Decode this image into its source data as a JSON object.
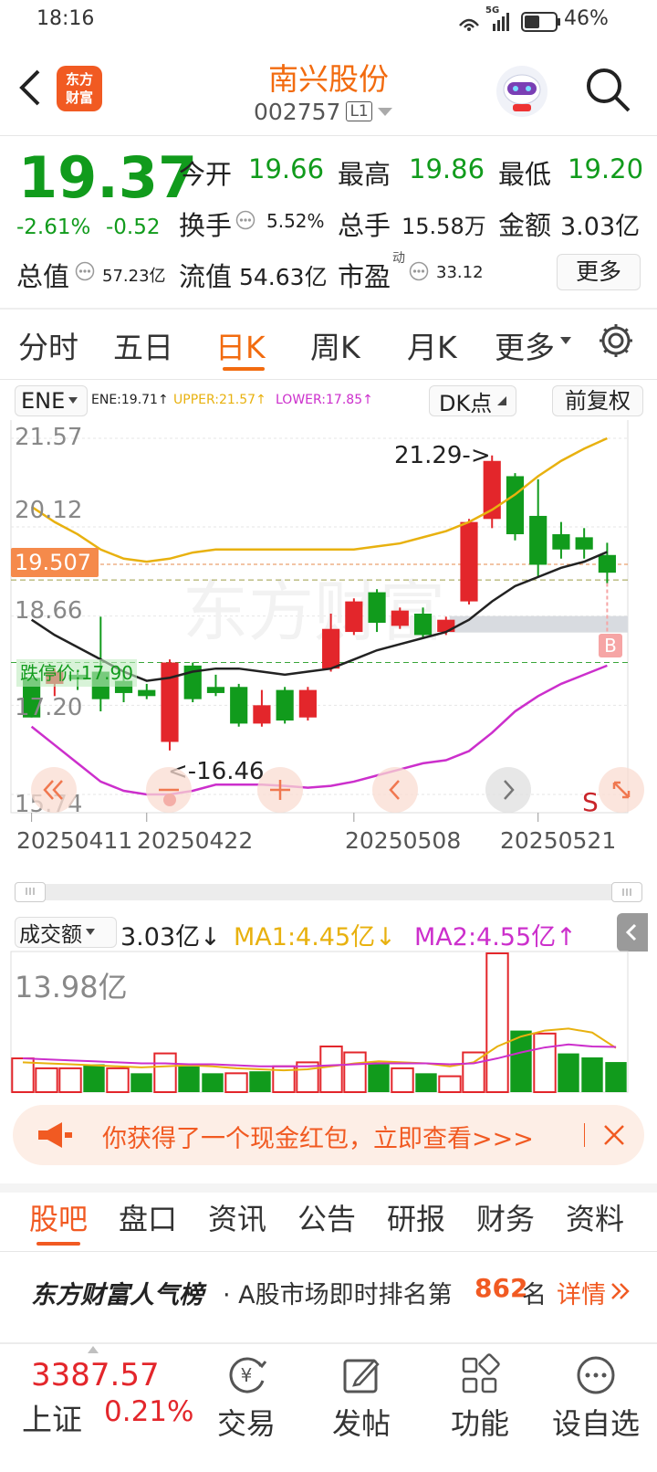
{
  "status_bar": {
    "time": "18:16",
    "network": "5G",
    "battery": "46%"
  },
  "header": {
    "title": "南兴股份",
    "code": "002757",
    "level": "L1",
    "logo_text": "东方财富"
  },
  "quote": {
    "price": "19.37",
    "change_pct": "-2.61%",
    "change": "-0.52",
    "open_label": "今开",
    "open": "19.66",
    "high_label": "最高",
    "high": "19.86",
    "low_label": "最低",
    "low": "19.20",
    "turnover_label": "换手",
    "turnover": "5.52%",
    "volume_label": "总手",
    "volume": "15.58万",
    "amount_label": "金额",
    "amount": "3.03亿",
    "mktcap_label": "总值",
    "mktcap": "57.23亿",
    "float_label": "流值",
    "float": "54.63亿",
    "pe_label": "市盈",
    "pe_sup": "动",
    "pe": "33.12",
    "more_button": "更多"
  },
  "tabs": [
    "分时",
    "五日",
    "日K",
    "周K",
    "月K",
    "更多"
  ],
  "active_tab": "日K",
  "indicator": {
    "name": "ENE",
    "ene": "ENE:19.71↑",
    "upper": "UPPER:21.57↑",
    "lower": "LOWER:17.85↑",
    "dk_button": "DK点",
    "adjust_button": "前复权"
  },
  "chart_data": [
    {
      "type": "candlestick",
      "y_ticks": [
        "21.57",
        "20.12",
        "18.66",
        "17.20",
        "15.74"
      ],
      "ylim": [
        15.74,
        21.57
      ],
      "price_tag": "19.507",
      "support_label": "跌停价:17.90",
      "high_annotation": "21.29->",
      "low_annotation": "<-16.46",
      "x_ticks": [
        "20250411",
        "20250422",
        "20250508",
        "20250521"
      ],
      "signals": [
        "B",
        "S"
      ],
      "candles": [
        {
          "o": 17.65,
          "c": 17.0,
          "h": 17.65,
          "l": 17.0
        },
        {
          "o": 17.55,
          "c": 17.75,
          "h": 17.8,
          "l": 17.35
        },
        {
          "o": 17.7,
          "c": 17.62,
          "h": 17.75,
          "l": 17.45
        },
        {
          "o": 17.75,
          "c": 17.3,
          "h": 18.65,
          "l": 17.1
        },
        {
          "o": 17.6,
          "c": 17.4,
          "h": 17.7,
          "l": 17.25
        },
        {
          "o": 17.45,
          "c": 17.35,
          "h": 17.55,
          "l": 17.3
        },
        {
          "o": 16.6,
          "c": 17.9,
          "h": 17.95,
          "l": 16.46
        },
        {
          "o": 17.85,
          "c": 17.3,
          "h": 17.9,
          "l": 17.25
        },
        {
          "o": 17.5,
          "c": 17.4,
          "h": 17.7,
          "l": 17.35
        },
        {
          "o": 17.5,
          "c": 16.9,
          "h": 17.55,
          "l": 16.85
        },
        {
          "o": 16.9,
          "c": 17.2,
          "h": 17.45,
          "l": 16.85
        },
        {
          "o": 17.45,
          "c": 16.95,
          "h": 17.5,
          "l": 16.9
        },
        {
          "o": 17.0,
          "c": 17.45,
          "h": 17.5,
          "l": 16.95
        },
        {
          "o": 17.8,
          "c": 18.45,
          "h": 18.7,
          "l": 17.75
        },
        {
          "o": 18.4,
          "c": 18.9,
          "h": 18.95,
          "l": 18.35
        },
        {
          "o": 19.05,
          "c": 18.55,
          "h": 19.1,
          "l": 18.4
        },
        {
          "o": 18.5,
          "c": 18.75,
          "h": 18.8,
          "l": 18.45
        },
        {
          "o": 18.7,
          "c": 18.35,
          "h": 18.8,
          "l": 18.3
        },
        {
          "o": 18.4,
          "c": 18.6,
          "h": 18.65,
          "l": 18.35
        },
        {
          "o": 18.9,
          "c": 20.2,
          "h": 20.25,
          "l": 18.85
        },
        {
          "o": 20.25,
          "c": 21.2,
          "h": 21.29,
          "l": 20.1
        },
        {
          "o": 20.95,
          "c": 20.0,
          "h": 21.0,
          "l": 19.9
        },
        {
          "o": 20.3,
          "c": 19.5,
          "h": 20.9,
          "l": 19.3
        },
        {
          "o": 20.0,
          "c": 19.75,
          "h": 20.2,
          "l": 19.6
        },
        {
          "o": 19.95,
          "c": 19.75,
          "h": 20.1,
          "l": 19.6
        },
        {
          "o": 19.66,
          "c": 19.37,
          "h": 19.86,
          "l": 19.2
        }
      ],
      "upper": [
        20.45,
        20.2,
        20.0,
        19.75,
        19.6,
        19.55,
        19.6,
        19.7,
        19.75,
        19.75,
        19.75,
        19.75,
        19.75,
        19.75,
        19.75,
        19.8,
        19.85,
        19.95,
        20.05,
        20.2,
        20.4,
        20.65,
        20.95,
        21.2,
        21.4,
        21.57
      ],
      "mid": [
        18.6,
        18.35,
        18.15,
        17.95,
        17.75,
        17.6,
        17.65,
        17.75,
        17.8,
        17.8,
        17.75,
        17.7,
        17.75,
        17.8,
        17.95,
        18.1,
        18.2,
        18.3,
        18.4,
        18.6,
        18.9,
        19.15,
        19.3,
        19.45,
        19.55,
        19.71
      ],
      "lower": [
        16.85,
        16.55,
        16.25,
        15.95,
        15.8,
        15.74,
        15.74,
        15.8,
        15.9,
        15.9,
        15.9,
        15.88,
        15.85,
        15.88,
        15.95,
        16.05,
        16.15,
        16.25,
        16.3,
        16.45,
        16.75,
        17.1,
        17.35,
        17.55,
        17.7,
        17.85
      ]
    },
    {
      "type": "bar",
      "label": "成交额",
      "value_text": "3.03亿↓",
      "ma1_text": "MA1:4.45亿↓",
      "ma2_text": "MA2:4.55亿↑",
      "ymax_label": "13.98亿",
      "ylim": [
        0,
        13.98
      ],
      "values": [
        3.4,
        2.4,
        2.4,
        2.8,
        2.4,
        1.9,
        3.9,
        2.6,
        1.9,
        1.9,
        2.1,
        2.6,
        3.0,
        4.6,
        4.0,
        3.0,
        2.4,
        1.9,
        1.6,
        4.0,
        13.98,
        6.2,
        5.9,
        3.9,
        3.5,
        3.03
      ],
      "colors": [
        "r",
        "r",
        "r",
        "g",
        "r",
        "g",
        "r",
        "g",
        "g",
        "r",
        "g",
        "r",
        "r",
        "r",
        "r",
        "g",
        "r",
        "g",
        "r",
        "r",
        "r",
        "g",
        "r",
        "g",
        "g",
        "g"
      ],
      "ma1": [
        3.0,
        2.9,
        2.8,
        2.7,
        2.6,
        2.5,
        2.6,
        2.7,
        2.6,
        2.4,
        2.3,
        2.2,
        2.3,
        2.6,
        2.9,
        3.1,
        3.0,
        2.9,
        2.6,
        3.0,
        4.6,
        5.6,
        6.2,
        6.4,
        6.0,
        4.45
      ],
      "ma2": [
        3.4,
        3.3,
        3.2,
        3.1,
        3.0,
        2.9,
        2.9,
        2.8,
        2.8,
        2.7,
        2.6,
        2.6,
        2.6,
        2.7,
        2.8,
        2.9,
        2.9,
        2.9,
        2.8,
        2.9,
        3.4,
        4.0,
        4.5,
        4.8,
        4.6,
        4.55
      ]
    }
  ],
  "banner": {
    "text": "你获得了一个现金红包，立即查看>>>"
  },
  "sub_tabs": [
    "股吧",
    "盘口",
    "资讯",
    "公告",
    "研报",
    "财务",
    "资料"
  ],
  "ranking": {
    "brand": "东方财富人气榜",
    "prefix": "· A股市场即时排名第",
    "rank": "862",
    "suffix": "名",
    "link": "详情"
  },
  "bottom_bar": {
    "index_value": "3387.57",
    "index_name": "上证",
    "index_change": "0.21%",
    "items": [
      {
        "label": "交易",
        "icon": "yen-icon"
      },
      {
        "label": "发帖",
        "icon": "edit-icon"
      },
      {
        "label": "功能",
        "icon": "grid-icon"
      },
      {
        "label": "设自选",
        "icon": "more-icon"
      }
    ]
  },
  "colors": {
    "up": "#e3262b",
    "down": "#119b1c",
    "accent": "#f26b0f",
    "upper": "#e8b10f",
    "lower": "#cc2fcc",
    "mid": "#222222"
  }
}
